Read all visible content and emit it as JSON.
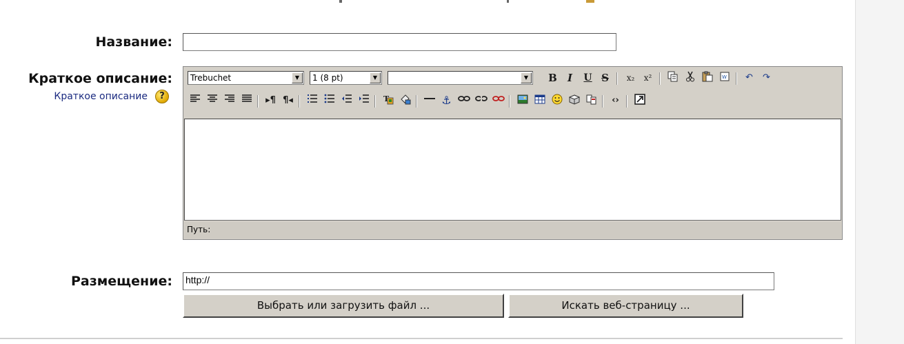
{
  "form": {
    "name_label": "Название:",
    "name_value": "",
    "summary_label": "Краткое описание:",
    "summary_help_link": "Краткое описание",
    "location_label": "Размещение:",
    "location_value": "http://"
  },
  "editor": {
    "font_family": "Trebuchet",
    "font_size": "1 (8 pt)",
    "format_value": "",
    "path_label": "Путь:",
    "toolbar_row1": [
      "bold",
      "italic",
      "underline",
      "strikethrough",
      "subscript",
      "superscript",
      "copy",
      "cut",
      "paste",
      "paste-word",
      "undo",
      "redo"
    ],
    "toolbar_row2": [
      "align-left",
      "align-center",
      "align-right",
      "justify",
      "ltr",
      "rtl",
      "ordered-list",
      "unordered-list",
      "outdent",
      "indent",
      "text-color",
      "background-color",
      "horizontal-rule",
      "anchor",
      "link",
      "unlink",
      "no-link",
      "image",
      "table",
      "smiley",
      "insert-char",
      "search-replace",
      "html-source",
      "fullscreen"
    ]
  },
  "buttons": {
    "choose_file": "Выбрать или загрузить файл ...",
    "search_web": "Искать веб-страницу ..."
  },
  "icons": {
    "help": "?",
    "dropdown": "▼"
  }
}
